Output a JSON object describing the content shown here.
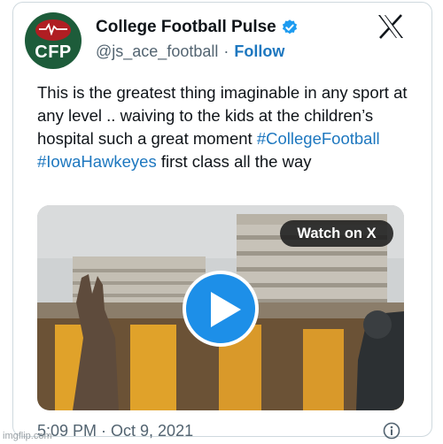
{
  "account": {
    "display_name": "College Football Pulse",
    "handle": "@js_ace_football",
    "separator": "·",
    "follow_label": "Follow",
    "avatar_logo_text": "CFP"
  },
  "tweet": {
    "text_part1": "This is the greatest thing imaginable in any sport at any level .. waiving to the kids at the children’s hospital such a great moment ",
    "hashtag1": "#CollegeFootball",
    "space": " ",
    "hashtag2": "#IowaHawkeyes",
    "text_part2": " first class all the way"
  },
  "media": {
    "watch_label": "Watch on X",
    "play_icon": "play-icon"
  },
  "footer": {
    "timestamp": "5:09 PM · Oct 9, 2021",
    "info_icon": "info-icon"
  },
  "watermark": "imgflip.com",
  "colors": {
    "link": "#1d77bf",
    "verified": "#1d9bf0",
    "avatar_bg": "#1d5c3a",
    "avatar_ball": "#b01e23",
    "play_button": "#1d8fe8",
    "stadium_gold": "#e0a22a"
  }
}
